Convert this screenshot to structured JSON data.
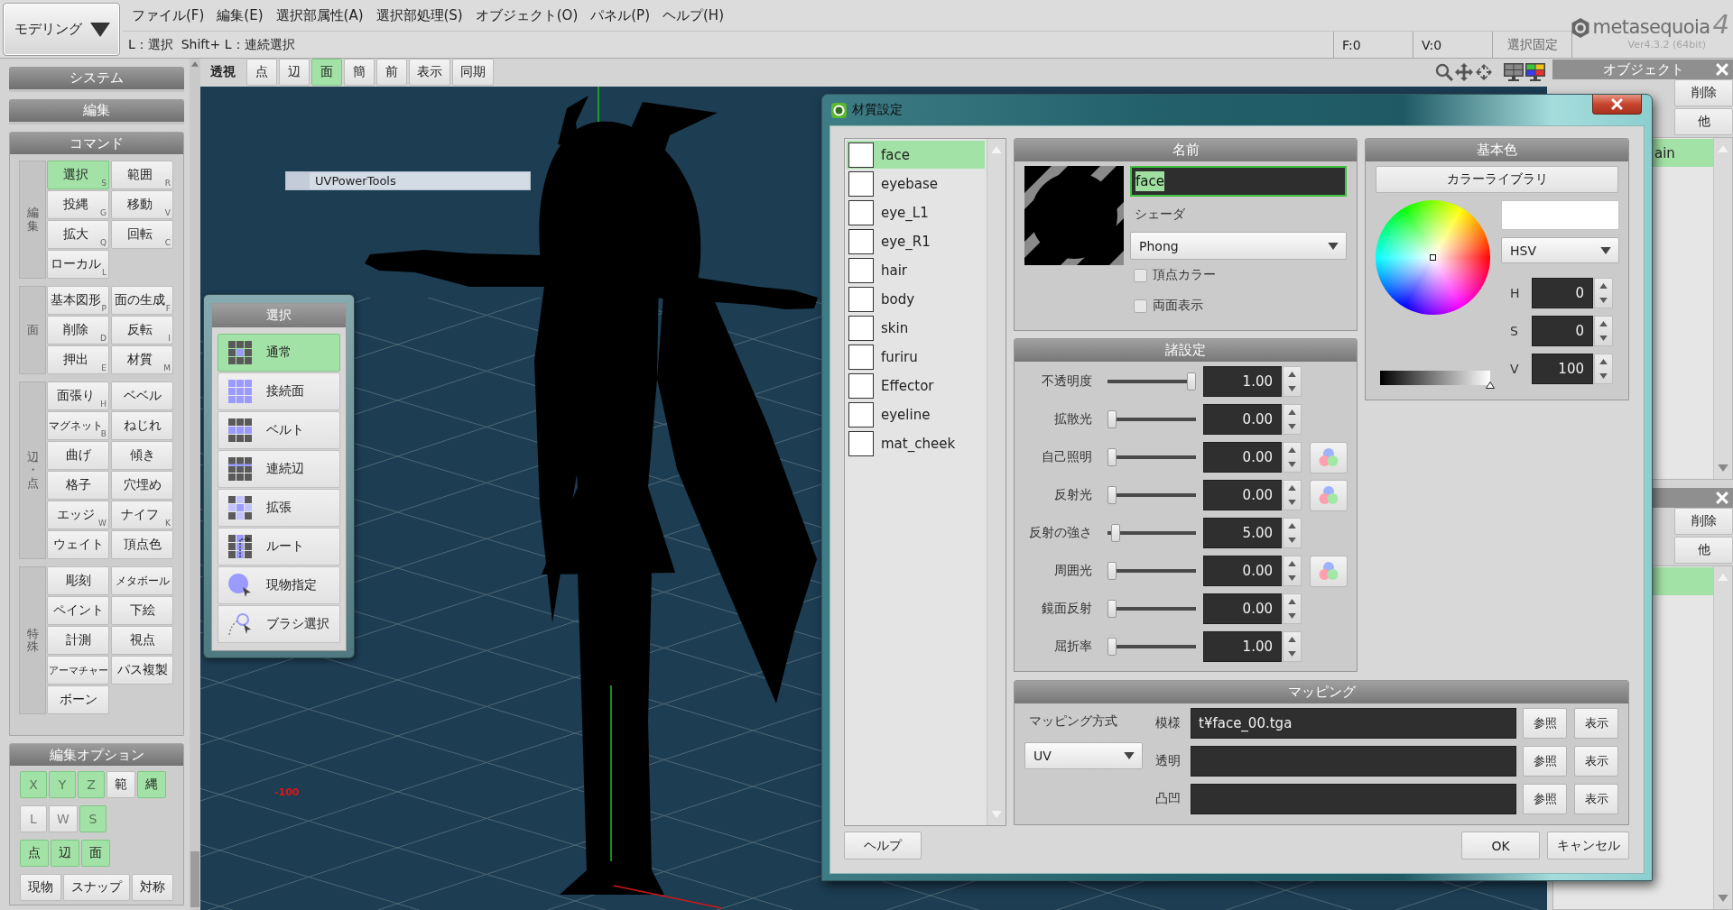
{
  "mode_selector": {
    "label": "モデリング"
  },
  "menu": [
    "ファイル(F)",
    "編集(E)",
    "選択部属性(A)",
    "選択部処理(S)",
    "オブジェクト(O)",
    "パネル(P)",
    "ヘルプ(H)"
  ],
  "hint": "L：選択  Shift+ L：連続選択",
  "counters": [
    "F:0",
    "V:0"
  ],
  "lock_button": "選択固定",
  "logo": {
    "name": "metasequoia",
    "mark": "4",
    "version": "Ver4.3.2 (64bit)"
  },
  "left_panel": {
    "sections": [
      "システム",
      "編集"
    ],
    "command": {
      "title": "コマンド",
      "groups": [
        {
          "label": "編集",
          "buttons": [
            {
              "label": "選択",
              "key": "S",
              "selected": true
            },
            {
              "label": "範囲",
              "key": "R",
              "selected": false
            },
            {
              "label": "投縄",
              "key": "G",
              "selected": false
            },
            {
              "label": "移動",
              "key": "V",
              "selected": false
            },
            {
              "label": "拡大",
              "key": "Q",
              "selected": false
            },
            {
              "label": "回転",
              "key": "C",
              "selected": false
            },
            {
              "label": "ローカル",
              "key": "L",
              "selected": false
            }
          ]
        },
        {
          "label": "面",
          "buttons": [
            {
              "label": "基本図形",
              "key": "P",
              "selected": false
            },
            {
              "label": "面の生成",
              "key": "F",
              "selected": false
            },
            {
              "label": "削除",
              "key": "D",
              "selected": false
            },
            {
              "label": "反転",
              "key": "I",
              "selected": false
            },
            {
              "label": "押出",
              "key": "E",
              "selected": false
            },
            {
              "label": "材質",
              "key": "M",
              "selected": false
            }
          ]
        },
        {
          "label": "辺・点",
          "buttons": [
            {
              "label": "面張り",
              "key": "H",
              "selected": false
            },
            {
              "label": "ベベル",
              "selected": false
            },
            {
              "label": "マグネット",
              "key": "B",
              "selected": false
            },
            {
              "label": "ねじれ",
              "selected": false
            },
            {
              "label": "曲げ",
              "selected": false
            },
            {
              "label": "傾き",
              "selected": false
            },
            {
              "label": "格子",
              "selected": false
            },
            {
              "label": "穴埋め",
              "selected": false
            },
            {
              "label": "エッジ",
              "key": "W",
              "selected": false
            },
            {
              "label": "ナイフ",
              "key": "K",
              "selected": false
            },
            {
              "label": "ウェイト",
              "selected": false
            },
            {
              "label": "頂点色",
              "selected": false
            }
          ]
        },
        {
          "label": "特殊",
          "buttons": [
            {
              "label": "彫刻",
              "selected": false
            },
            {
              "label": "メタボール",
              "selected": false
            },
            {
              "label": "ペイント",
              "selected": false
            },
            {
              "label": "下絵",
              "selected": false
            },
            {
              "label": "計測",
              "selected": false
            },
            {
              "label": "視点",
              "selected": false
            },
            {
              "label": "アーマチャー",
              "selected": false
            },
            {
              "label": "パス複製",
              "selected": false
            },
            {
              "label": "ボーン",
              "selected": false
            }
          ]
        }
      ]
    },
    "edit_options": {
      "title": "編集オプション",
      "rows": [
        {
          "options": [
            {
              "label": "X",
              "on": true,
              "disabled": true
            },
            {
              "label": "Y",
              "on": true,
              "disabled": true
            },
            {
              "label": "Z",
              "on": true,
              "disabled": true
            },
            {
              "label": "範",
              "on": false,
              "disabled": false
            },
            {
              "label": "縄",
              "on": true,
              "disabled": false
            }
          ]
        },
        {
          "options": [
            {
              "label": "L",
              "on": false,
              "disabled": true
            },
            {
              "label": "W",
              "on": false,
              "disabled": true
            },
            {
              "label": "S",
              "on": true,
              "disabled": true
            }
          ]
        },
        {
          "options": [
            {
              "label": "点",
              "on": true,
              "disabled": false
            },
            {
              "label": "辺",
              "on": true,
              "disabled": false
            },
            {
              "label": "面",
              "on": true,
              "disabled": false
            }
          ]
        },
        {
          "options": [
            {
              "label": "現物",
              "on": false,
              "disabled": false
            },
            {
              "label": "スナップ",
              "on": false,
              "disabled": false
            },
            {
              "label": "対称",
              "on": false,
              "disabled": false
            }
          ]
        }
      ]
    }
  },
  "viewport": {
    "toolbar": {
      "label": "透視",
      "buttons": [
        {
          "label": "点",
          "selected": false
        },
        {
          "label": "辺",
          "selected": false
        },
        {
          "label": "面",
          "selected": true
        },
        {
          "label": "簡",
          "selected": false
        },
        {
          "label": "前",
          "selected": false
        },
        {
          "label": "表示",
          "selected": false
        },
        {
          "label": "同期",
          "selected": false
        }
      ]
    },
    "plugin_menu_item": "UVPowerTools",
    "axis_label": "-100",
    "select_panel": {
      "title": "選択",
      "items": [
        {
          "label": "通常",
          "selected": true
        },
        {
          "label": "接続面",
          "selected": false
        },
        {
          "label": "ベルト",
          "selected": false
        },
        {
          "label": "連続辺",
          "selected": false
        },
        {
          "label": "拡張",
          "selected": false
        },
        {
          "label": "ルート",
          "selected": false
        },
        {
          "label": "現物指定",
          "selected": false
        },
        {
          "label": "ブラシ選択",
          "selected": false
        }
      ]
    }
  },
  "object_panels": [
    {
      "title": "オブジェクト",
      "buttons": [
        "削除",
        "他"
      ],
      "rows": [
        {
          "label": "ain",
          "selected": true
        }
      ]
    },
    {
      "buttons": [
        "削除",
        "他"
      ],
      "rows": [
        {
          "selected": true
        }
      ]
    }
  ],
  "dialog": {
    "title": "材質設定",
    "materials": [
      {
        "name": "face",
        "selected": true
      },
      {
        "name": "eyebase",
        "selected": false
      },
      {
        "name": "eye_L1",
        "selected": false
      },
      {
        "name": "eye_R1",
        "selected": false
      },
      {
        "name": "hair",
        "selected": false
      },
      {
        "name": "body",
        "selected": false
      },
      {
        "name": "skin",
        "selected": false
      },
      {
        "name": "furiru",
        "selected": false
      },
      {
        "name": "Effector",
        "selected": false
      },
      {
        "name": "eyeline",
        "selected": false
      },
      {
        "name": "mat_cheek",
        "selected": false
      }
    ],
    "help_button": "ヘルプ",
    "name_panel": {
      "title": "名前",
      "name": "face",
      "name_selected": true,
      "shader_label": "シェーダ",
      "shader": "Phong",
      "options": [
        {
          "label": "頂点カラー",
          "checked": false
        },
        {
          "label": "両面表示",
          "checked": false
        }
      ]
    },
    "settings_panel": {
      "title": "諸設定",
      "rows": [
        {
          "label": "不透明度",
          "level": 1,
          "value": "1.00",
          "color_button": false
        },
        {
          "label": "拡散光",
          "level": 0,
          "value": "0.00",
          "color_button": false
        },
        {
          "label": "自己照明",
          "level": 0,
          "value": "0.00",
          "color_button": true
        },
        {
          "label": "反射光",
          "level": 0,
          "value": "0.00",
          "color_button": true
        },
        {
          "label": "反射の強さ",
          "level": 0.05,
          "value": "5.00",
          "color_button": false
        },
        {
          "label": "周囲光",
          "level": 0,
          "value": "0.00",
          "color_button": true
        },
        {
          "label": "鏡面反射",
          "level": 0,
          "value": "0.00",
          "color_button": false
        },
        {
          "label": "屈折率",
          "level": 0,
          "value": "1.00",
          "color_button": false
        }
      ]
    },
    "color_panel": {
      "title": "基本色",
      "library_button": "カラーライブラリ",
      "color_model": "HSV",
      "channels": [
        {
          "label": "H",
          "value": "0"
        },
        {
          "label": "S",
          "value": "0"
        },
        {
          "label": "V",
          "value": "100"
        }
      ],
      "value_bar": {
        "level": 1
      }
    },
    "mapping_panel": {
      "title": "マッピング",
      "method_label": "マッピング方式",
      "method": "UV",
      "rows": [
        {
          "label": "模様",
          "value": "t¥face_00.tga",
          "browse_button": "参照",
          "show_button": "表示"
        },
        {
          "label": "透明",
          "browse_button": "参照",
          "show_button": "表示"
        },
        {
          "label": "凸凹",
          "browse_button": "参照",
          "show_button": "表示"
        }
      ]
    },
    "buttons": [
      "OK",
      "キャンセル"
    ]
  }
}
